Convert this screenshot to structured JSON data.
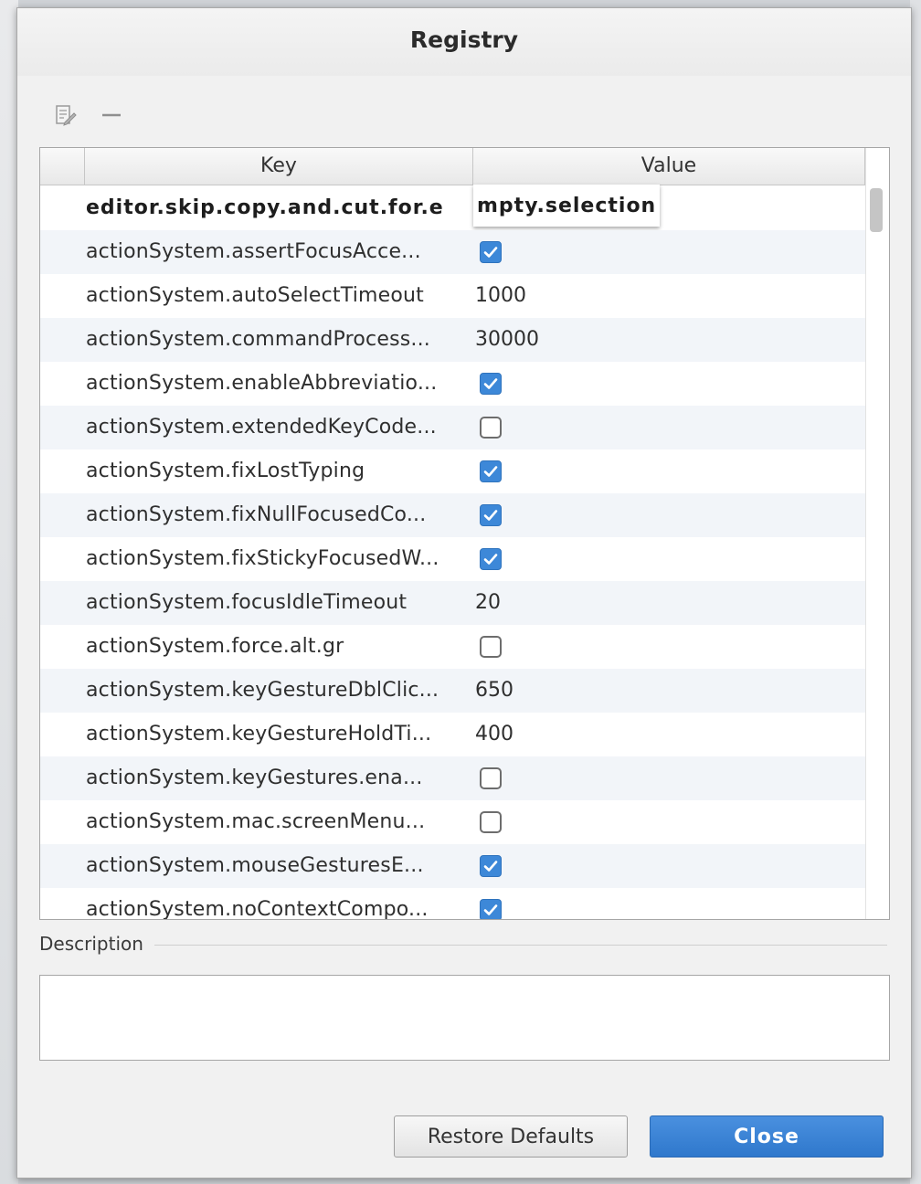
{
  "dialog": {
    "title": "Registry"
  },
  "toolbar": {
    "edit_icon": "edit-icon",
    "remove_icon": "minus-icon"
  },
  "table": {
    "columns": {
      "key": "Key",
      "value": "Value"
    },
    "rows": [
      {
        "key": "editor.skip.copy.and.cut.for.e",
        "key_overflow": "mpty.selection",
        "value_type": "none",
        "value": ""
      },
      {
        "key": "actionSystem.assertFocusAcce...",
        "value_type": "bool",
        "value": true
      },
      {
        "key": "actionSystem.autoSelectTimeout",
        "value_type": "text",
        "value": "1000"
      },
      {
        "key": "actionSystem.commandProcess...",
        "value_type": "text",
        "value": "30000"
      },
      {
        "key": "actionSystem.enableAbbreviatio...",
        "value_type": "bool",
        "value": true
      },
      {
        "key": "actionSystem.extendedKeyCode...",
        "value_type": "bool",
        "value": false
      },
      {
        "key": "actionSystem.fixLostTyping",
        "value_type": "bool",
        "value": true
      },
      {
        "key": "actionSystem.fixNullFocusedCo...",
        "value_type": "bool",
        "value": true
      },
      {
        "key": "actionSystem.fixStickyFocusedW...",
        "value_type": "bool",
        "value": true
      },
      {
        "key": "actionSystem.focusIdleTimeout",
        "value_type": "text",
        "value": "20"
      },
      {
        "key": "actionSystem.force.alt.gr",
        "value_type": "bool",
        "value": false
      },
      {
        "key": "actionSystem.keyGestureDblClic...",
        "value_type": "text",
        "value": "650"
      },
      {
        "key": "actionSystem.keyGestureHoldTi...",
        "value_type": "text",
        "value": "400"
      },
      {
        "key": "actionSystem.keyGestures.ena...",
        "value_type": "bool",
        "value": false
      },
      {
        "key": "actionSystem.mac.screenMenu...",
        "value_type": "bool",
        "value": false
      },
      {
        "key": "actionSystem.mouseGesturesE...",
        "value_type": "bool",
        "value": true
      },
      {
        "key": "actionSystem.noContextCompo...",
        "value_type": "bool",
        "value": true
      }
    ]
  },
  "description": {
    "label": "Description",
    "text": ""
  },
  "buttons": {
    "restore": "Restore Defaults",
    "close": "Close"
  },
  "colors": {
    "accent": "#3d88d8",
    "row_alt": "#f2f5f9"
  }
}
